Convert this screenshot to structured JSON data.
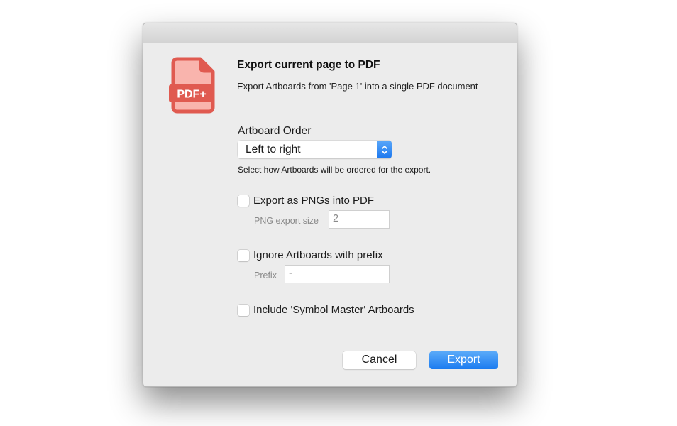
{
  "dialog": {
    "icon": "pdf-plus-icon",
    "icon_badge": "PDF+",
    "title": "Export current page to PDF",
    "description": "Export Artboards from 'Page 1' into a single PDF document"
  },
  "artboard_order": {
    "label": "Artboard Order",
    "selected": "Left to right",
    "help": "Select how Artboards will be ordered for the export."
  },
  "options": {
    "export_pngs": {
      "label": "Export as PNGs into PDF",
      "checked": false,
      "size_label": "PNG export size",
      "size_value": "2"
    },
    "ignore_prefix": {
      "label": "Ignore Artboards with prefix",
      "checked": false,
      "prefix_label": "Prefix",
      "prefix_value": "-"
    },
    "symbol_master": {
      "label": "Include 'Symbol Master' Artboards",
      "checked": false
    }
  },
  "buttons": {
    "cancel": "Cancel",
    "export": "Export"
  },
  "colors": {
    "accent": "#1c7bf0",
    "icon": "#e05a50",
    "icon_fill": "#f9b4ad"
  }
}
